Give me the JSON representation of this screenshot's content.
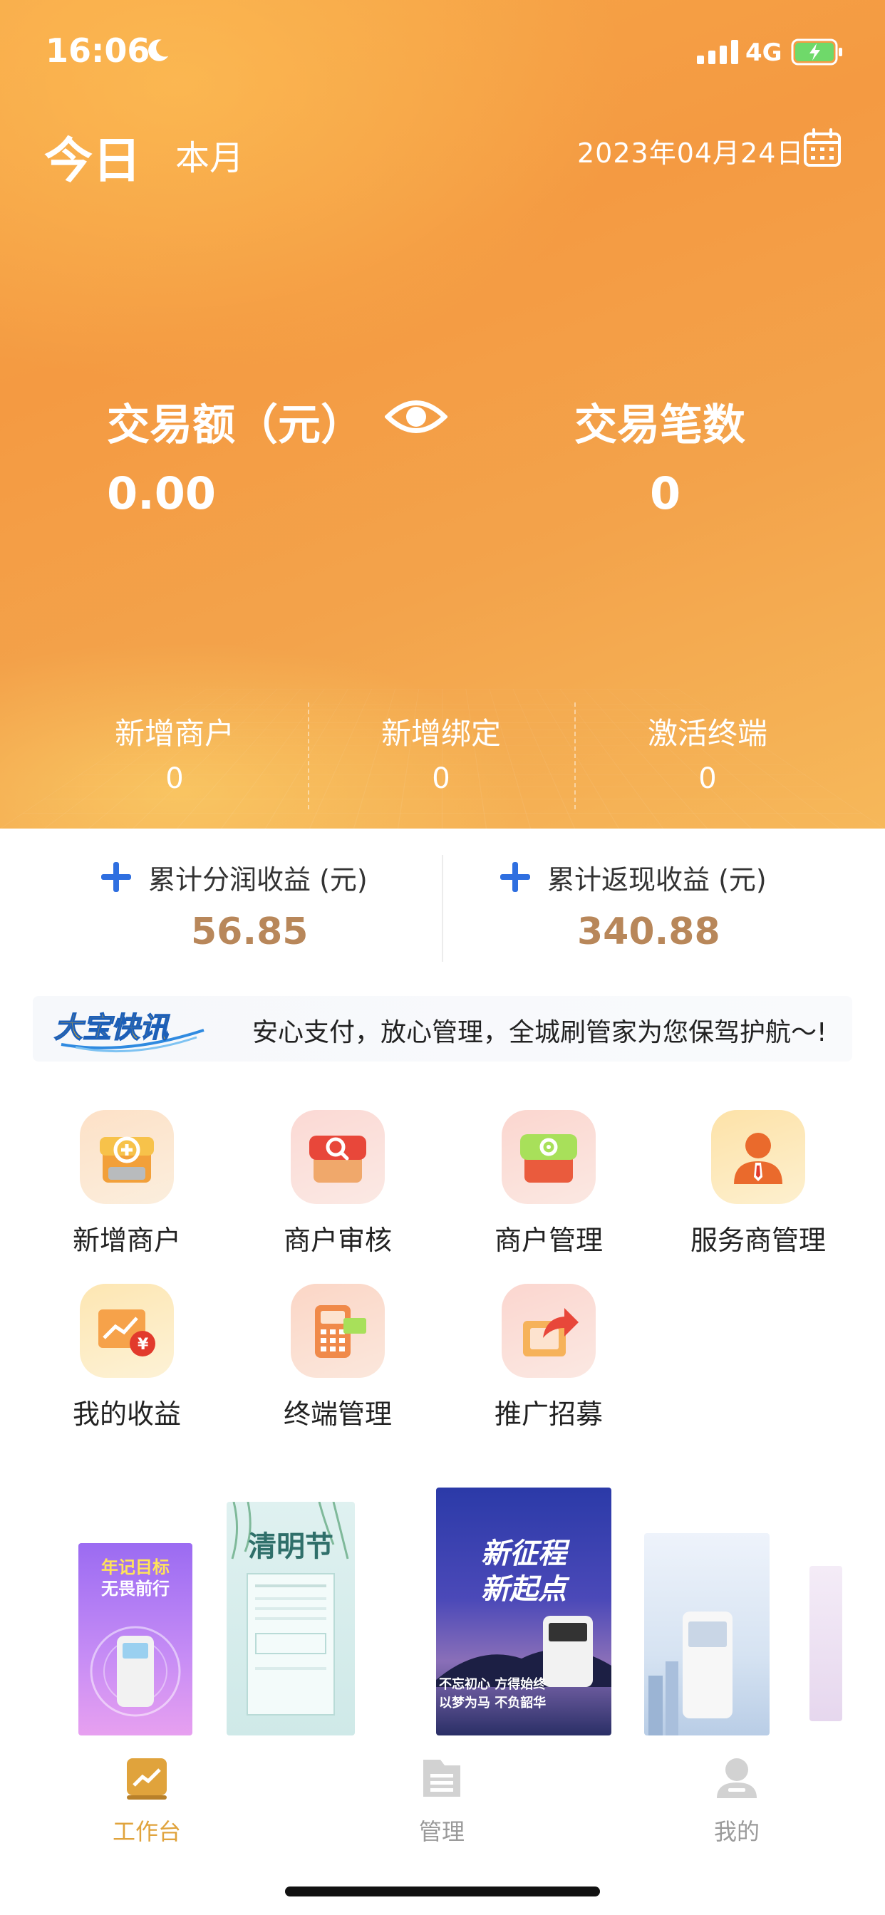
{
  "status_bar": {
    "time": "16:06",
    "network": "4G"
  },
  "header": {
    "tabs": [
      {
        "label": "今日"
      },
      {
        "label": "本月"
      }
    ],
    "date": "2023年04月24日"
  },
  "stats": {
    "amount_label": "交易额（元）",
    "amount_value": "0.00",
    "count_label": "交易笔数",
    "count_value": "0"
  },
  "sub_stats": [
    {
      "label": "新增商户",
      "value": "0"
    },
    {
      "label": "新增绑定",
      "value": "0"
    },
    {
      "label": "激活终端",
      "value": "0"
    }
  ],
  "earnings": [
    {
      "label": "累计分润收益 (元)",
      "value": "56.85"
    },
    {
      "label": "累计返现收益 (元)",
      "value": "340.88"
    }
  ],
  "news": {
    "logo_text": "大宝快讯",
    "message": "安心支付，放心管理，全城刷管家为您保驾护航～!"
  },
  "menu": [
    {
      "label": "新增商户",
      "icon": "add-store-icon"
    },
    {
      "label": "商户审核",
      "icon": "search-store-icon"
    },
    {
      "label": "商户管理",
      "icon": "settings-store-icon"
    },
    {
      "label": "服务商管理",
      "icon": "person-icon"
    },
    {
      "label": "我的收益",
      "icon": "income-chart-icon"
    },
    {
      "label": "终端管理",
      "icon": "terminal-icon"
    },
    {
      "label": "推广招募",
      "icon": "share-icon"
    }
  ],
  "posters": [
    {
      "title_line1": "年记目标",
      "title_line2": "无畏前行"
    },
    {
      "title_line1": "清明节",
      "title_line2": ""
    },
    {
      "title_line1": "新征程",
      "title_line2": "新起点",
      "caption_line1": "不忘初心 方得始终",
      "caption_line2": "以梦为马 不负韶华"
    },
    {
      "title_line1": "",
      "title_line2": ""
    },
    {
      "title_line1": "",
      "title_line2": ""
    }
  ],
  "bottom_nav": [
    {
      "label": "工作台",
      "icon": "dashboard-icon",
      "active": true
    },
    {
      "label": "管理",
      "icon": "list-icon",
      "active": false
    },
    {
      "label": "我的",
      "icon": "user-icon",
      "active": false
    }
  ],
  "colors": {
    "hero_orange": "#f49a42",
    "earnings_gold": "#b8875a",
    "accent_blue": "#2f6fe0",
    "nav_active": "#e0a33c",
    "nav_inactive": "#9a9a9a"
  }
}
